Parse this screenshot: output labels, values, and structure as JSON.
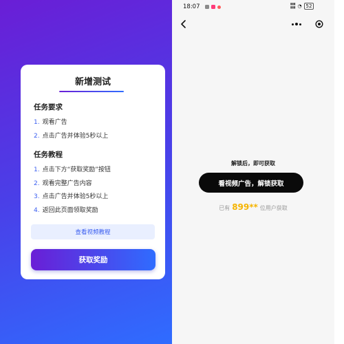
{
  "left": {
    "title": "新增测试",
    "requirements": {
      "heading": "任务要求",
      "items": [
        {
          "num": "1.",
          "text": "观看广告"
        },
        {
          "num": "2.",
          "text": "点击广告并体验5秒以上"
        }
      ]
    },
    "tutorial": {
      "heading": "任务教程",
      "items": [
        {
          "num": "1.",
          "text": "点击下方“获取奖励”按钮"
        },
        {
          "num": "2.",
          "text": "观看完整广告内容"
        },
        {
          "num": "3.",
          "text": "点击广告并体验5秒以上"
        },
        {
          "num": "4.",
          "text": "返回此页面领取奖励"
        }
      ]
    },
    "video_tutorial_label": "查看视频教程",
    "claim_label": "获取奖励"
  },
  "right": {
    "status": {
      "time": "18:07",
      "battery": "52"
    },
    "unlock_tip": "解锁后，即可获取",
    "watch_ad_label": "看视频广告，解锁获取",
    "stats": {
      "prefix": "已有",
      "count": "899**",
      "suffix": "位用户获取"
    }
  },
  "colors": {
    "gradient_start": "#6a1ed6",
    "gradient_end": "#2f6cff",
    "accent_blue": "#3a5ef0",
    "count_yellow": "#f5b400",
    "dark_button": "#0a0a0a"
  },
  "icons": [
    "back-icon",
    "more-icon",
    "target-icon"
  ]
}
